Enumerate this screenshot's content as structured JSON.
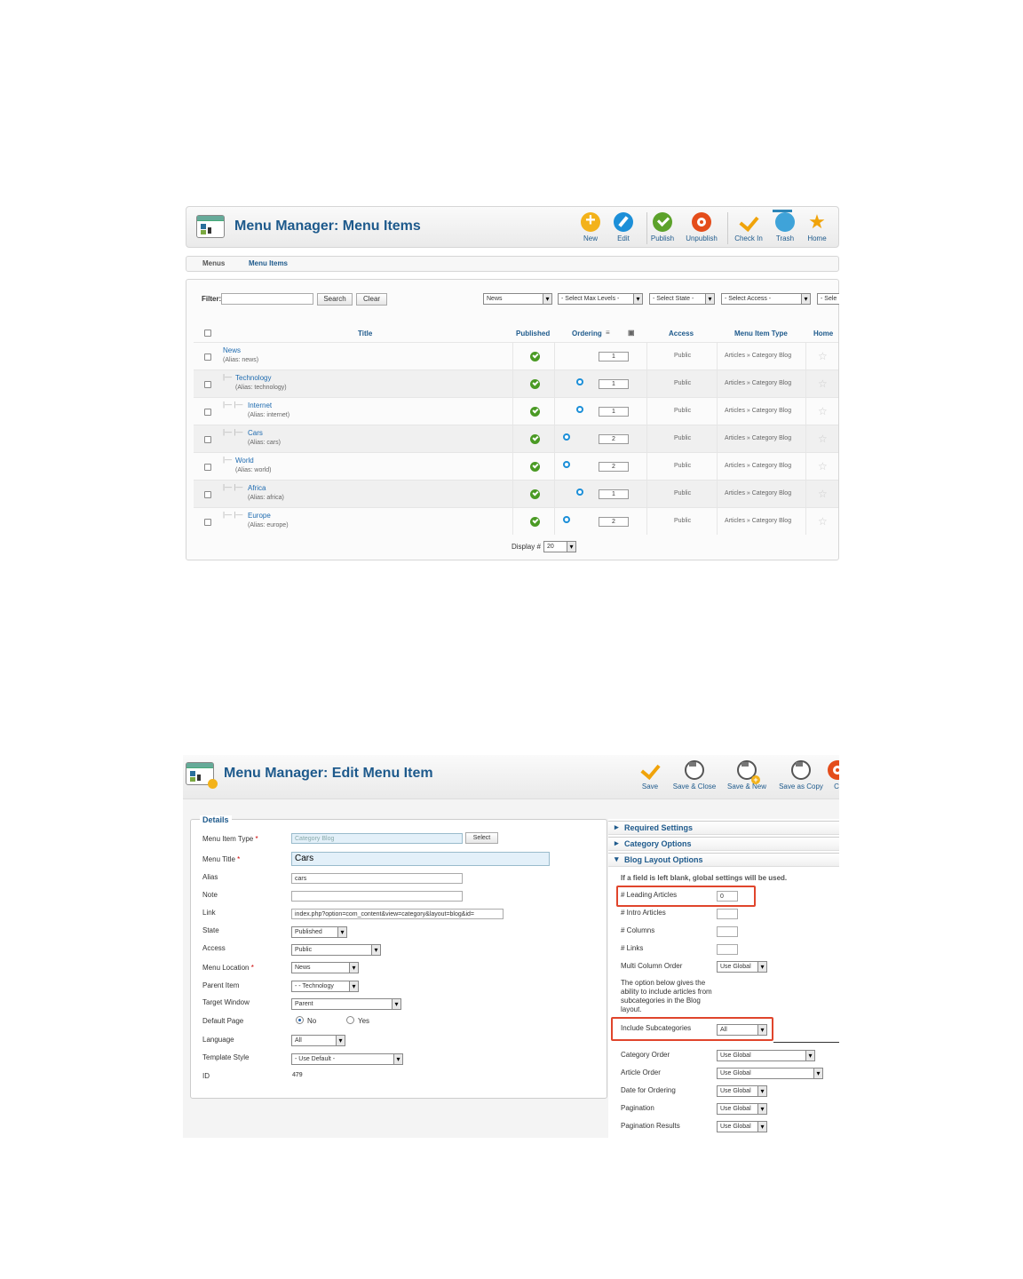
{
  "list_screen": {
    "title": "Menu Manager: Menu Items",
    "toolbar": [
      {
        "label": "New",
        "icon": "new-icon"
      },
      {
        "label": "Edit",
        "icon": "edit-icon"
      },
      {
        "label": "Publish",
        "icon": "publish-icon"
      },
      {
        "label": "Unpublish",
        "icon": "unpublish-icon"
      },
      {
        "label": "Check In",
        "icon": "check-in-icon"
      },
      {
        "label": "Trash",
        "icon": "trash-icon"
      },
      {
        "label": "Home",
        "icon": "home-star-icon"
      }
    ],
    "submenu": {
      "menus": "Menus",
      "menu_items": "Menu Items"
    },
    "filter": {
      "label": "Filter:",
      "value": "",
      "search_button": "Search",
      "clear_button": "Clear",
      "menu_select": "News",
      "max_levels_select": "- Select Max Levels -",
      "state_select": "- Select State -",
      "access_select": "- Select Access -",
      "language_select": "- Sele"
    },
    "columns": {
      "title": "Title",
      "published": "Published",
      "ordering": "Ordering",
      "access": "Access",
      "type": "Menu Item Type",
      "home": "Home"
    },
    "rows": [
      {
        "title": "News",
        "alias": "(Alias: news)",
        "tree": "",
        "order": "1",
        "access": "Public",
        "type": "Articles » Category Blog"
      },
      {
        "title": "Technology",
        "alias": "(Alias: technology)",
        "tree": "|—",
        "order": "1",
        "access": "Public",
        "type": "Articles » Category Blog"
      },
      {
        "title": "Internet",
        "alias": "(Alias: internet)",
        "tree": "|— |—",
        "order": "1",
        "access": "Public",
        "type": "Articles » Category Blog"
      },
      {
        "title": "Cars",
        "alias": "(Alias: cars)",
        "tree": "|— |—",
        "order": "2",
        "access": "Public",
        "type": "Articles » Category Blog"
      },
      {
        "title": "World",
        "alias": "(Alias: world)",
        "tree": "|—",
        "order": "2",
        "access": "Public",
        "type": "Articles » Category Blog"
      },
      {
        "title": "Africa",
        "alias": "(Alias: africa)",
        "tree": "|— |—",
        "order": "1",
        "access": "Public",
        "type": "Articles » Category Blog"
      },
      {
        "title": "Europe",
        "alias": "(Alias: europe)",
        "tree": "|— |—",
        "order": "2",
        "access": "Public",
        "type": "Articles » Category Blog"
      }
    ],
    "display": {
      "label": "Display #",
      "value": "20"
    }
  },
  "edit_screen": {
    "title": "Menu Manager: Edit Menu Item",
    "toolbar": [
      {
        "label": "Save",
        "icon": "save-checkmark-icon"
      },
      {
        "label": "Save & Close",
        "icon": "save-close-icon"
      },
      {
        "label": "Save & New",
        "icon": "save-new-icon"
      },
      {
        "label": "Save as Copy",
        "icon": "save-copy-icon"
      },
      {
        "label": "C",
        "icon": "close-icon"
      }
    ],
    "details": {
      "legend": "Details",
      "menu_item_type": {
        "label": "Menu Item Type",
        "value": "Category Blog",
        "button": "Select"
      },
      "menu_title": {
        "label": "Menu Title",
        "value": "Cars"
      },
      "alias": {
        "label": "Alias",
        "value": "cars"
      },
      "note": {
        "label": "Note",
        "value": ""
      },
      "link": {
        "label": "Link",
        "value": "index.php?option=com_content&view=category&layout=blog&id="
      },
      "state": {
        "label": "State",
        "value": "Published"
      },
      "access": {
        "label": "Access",
        "value": "Public"
      },
      "menu_location": {
        "label": "Menu Location",
        "value": "News"
      },
      "parent_item": {
        "label": "Parent Item",
        "value": "- - Technology"
      },
      "target_window": {
        "label": "Target Window",
        "value": "Parent"
      },
      "default_page": {
        "label": "Default Page",
        "no": "No",
        "yes": "Yes"
      },
      "language": {
        "label": "Language",
        "value": "All"
      },
      "template_style": {
        "label": "Template Style",
        "value": "- Use Default -"
      },
      "id": {
        "label": "ID",
        "value": "479"
      }
    },
    "options": {
      "required_settings": "Required Settings",
      "category_options": "Category Options",
      "blog_layout_options": "Blog Layout Options",
      "note": "If a field is left blank, global settings will be used.",
      "leading_articles": {
        "label": "# Leading Articles",
        "value": "0"
      },
      "intro_articles": {
        "label": "# Intro Articles",
        "value": ""
      },
      "columns": {
        "label": "# Columns",
        "value": ""
      },
      "links": {
        "label": "# Links",
        "value": ""
      },
      "multi_column_order": {
        "label": "Multi Column Order",
        "value": "Use Global"
      },
      "subcat_note": "The option below gives the ability to include articles from subcategories in the Blog layout.",
      "include_subcategories": {
        "label": "Include Subcategories",
        "value": "All"
      },
      "category_order": {
        "label": "Category Order",
        "value": "Use Global"
      },
      "article_order": {
        "label": "Article Order",
        "value": "Use Global"
      },
      "date_for_ordering": {
        "label": "Date for Ordering",
        "value": "Use Global"
      },
      "pagination": {
        "label": "Pagination",
        "value": "Use Global"
      },
      "pagination_results": {
        "label": "Pagination Results",
        "value": "Use Global"
      }
    }
  }
}
